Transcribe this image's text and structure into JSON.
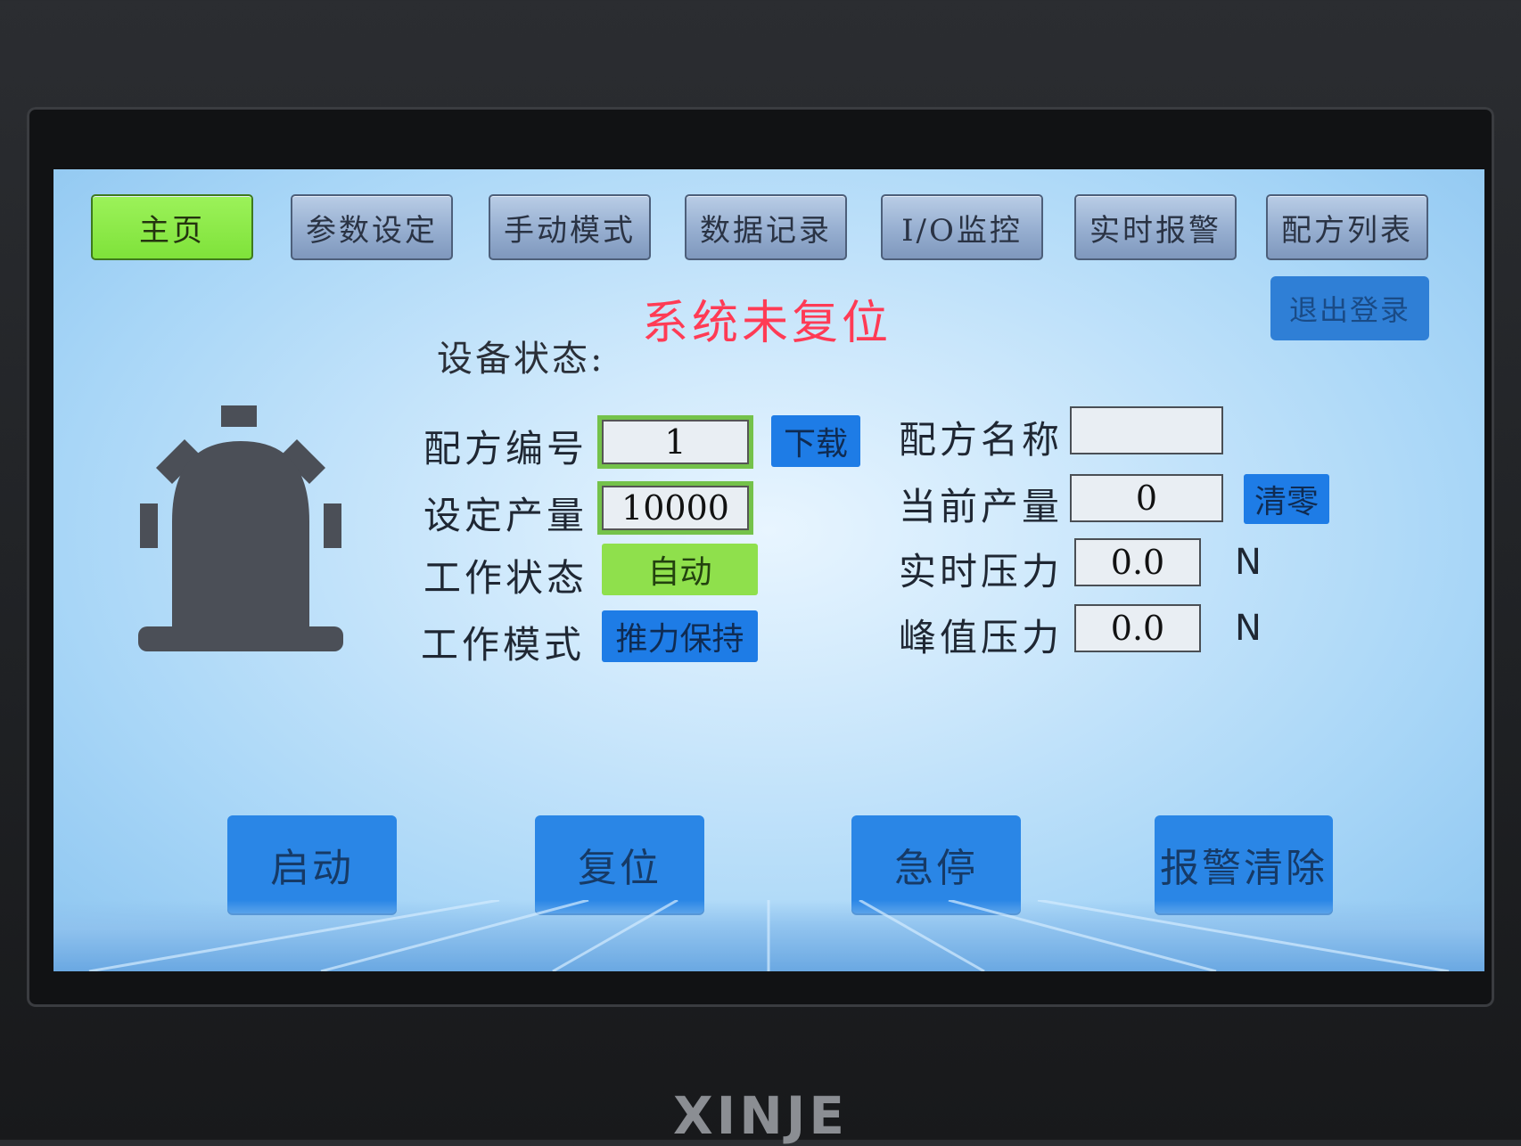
{
  "nav": {
    "home": "主页",
    "params": "参数设定",
    "manual": "手动模式",
    "data_log": "数据记录",
    "io": "I/O监控",
    "alarm": "实时报警",
    "recipes": "配方列表"
  },
  "logout_label": "退出登录",
  "status": {
    "label": "设备状态:",
    "value": "系统未复位"
  },
  "fields": {
    "recipe_no_label": "配方编号",
    "recipe_no_value": "1",
    "download_label": "下载",
    "target_qty_label": "设定产量",
    "target_qty_value": "10000",
    "work_state_label": "工作状态",
    "work_state_value": "自动",
    "work_mode_label": "工作模式",
    "work_mode_value": "推力保持",
    "recipe_name_label": "配方名称",
    "recipe_name_value": "",
    "current_qty_label": "当前产量",
    "current_qty_value": "0",
    "clear_label": "清零",
    "pressure_label": "实时压力",
    "pressure_value": "0.0",
    "pressure_unit": "N",
    "peak_label": "峰值压力",
    "peak_value": "0.0",
    "peak_unit": "N"
  },
  "actions": {
    "start": "启动",
    "reset": "复位",
    "estop": "急停",
    "alarm_clear": "报警清除"
  },
  "brand": "XINJE",
  "colors": {
    "active_tab": "#7fe23a",
    "action_blue": "#2a86e6",
    "status_red": "#ff3b55",
    "alarm_lamp": "#4b4f57"
  }
}
